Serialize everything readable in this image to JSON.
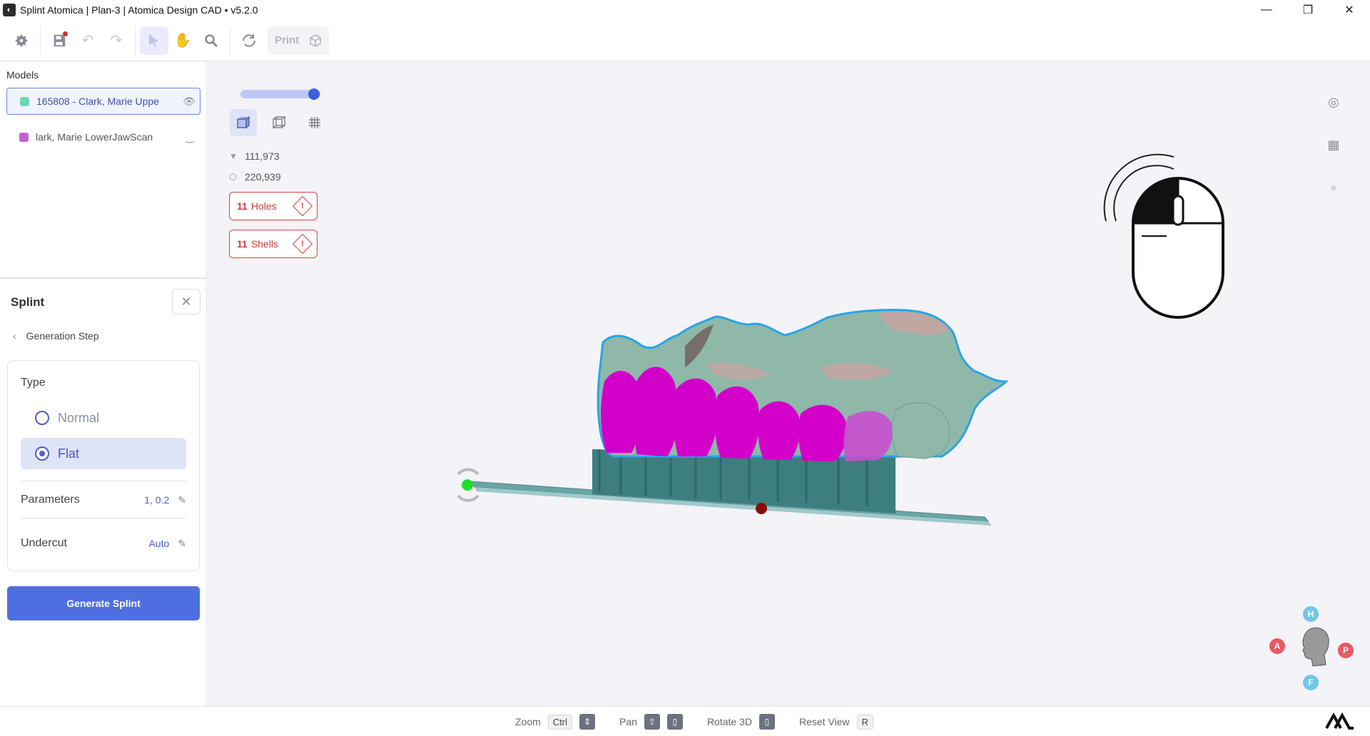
{
  "window": {
    "title": "Splint  Atomica | Plan-3 | Atomica Design CAD • v5.2.0",
    "minimize": "—",
    "restore": "❐",
    "close": "✕"
  },
  "toolbar": {
    "settings_icon": "gear-icon",
    "save_icon": "save-icon",
    "print_label": "Print",
    "colors": {
      "accent": "#4f6fe0",
      "unsaved_dot": "#d42a2a"
    }
  },
  "models": {
    "title": "Models",
    "items": [
      {
        "name": "165808 - Clark, Marie Uppe",
        "color": "#6fd8b0",
        "visible": true
      },
      {
        "name": "lark, Marie LowerJawScan",
        "color": "#c060d8",
        "visible": false
      }
    ]
  },
  "splint": {
    "title": "Splint",
    "close": "✕",
    "back_label": "Generation Step",
    "type_label": "Type",
    "options": [
      {
        "label": "Normal",
        "selected": false
      },
      {
        "label": "Flat",
        "selected": true
      }
    ],
    "parameters_label": "Parameters",
    "parameters_value": "1, 0.2",
    "undercut_label": "Undercut",
    "undercut_value": "Auto",
    "generate_button": "Generate Splint"
  },
  "viewport": {
    "opacity_level": 0.92,
    "vertex_count": "111,973",
    "face_count": "220,939",
    "holes_count": "11",
    "holes_label": "Holes",
    "shells_count": "11",
    "shells_label": "Shells",
    "warning_color": "#d23a3a"
  },
  "orientation": {
    "top": "H",
    "left": "A",
    "right": "P",
    "bottom": "F"
  },
  "hints": {
    "zoom_label": "Zoom",
    "zoom_key": "Ctrl",
    "pan_label": "Pan",
    "rotate_label": "Rotate 3D",
    "reset_label": "Reset View",
    "reset_key": "R"
  }
}
